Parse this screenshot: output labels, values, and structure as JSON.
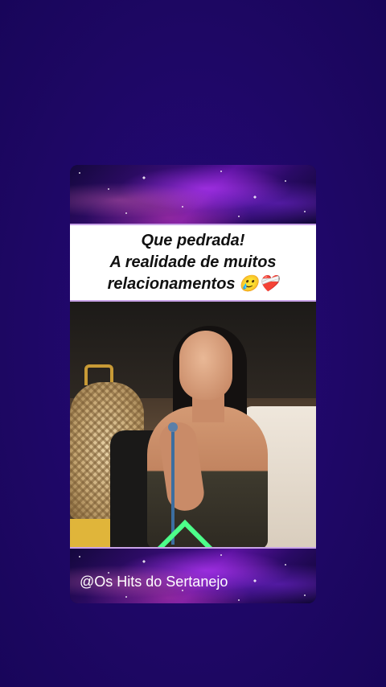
{
  "post": {
    "caption_lines": [
      "Que pedrada!",
      "A realidade de muitos",
      "relacionamentos"
    ],
    "caption_emojis": "🥲❤️‍🩹",
    "watermark": "@Os Hits do Sertanejo"
  },
  "colors": {
    "background": "#1e0866",
    "caption_bg": "#ffffff",
    "caption_text": "#111111",
    "divider": "#c8a2e8",
    "accent": "#4dff8a"
  }
}
